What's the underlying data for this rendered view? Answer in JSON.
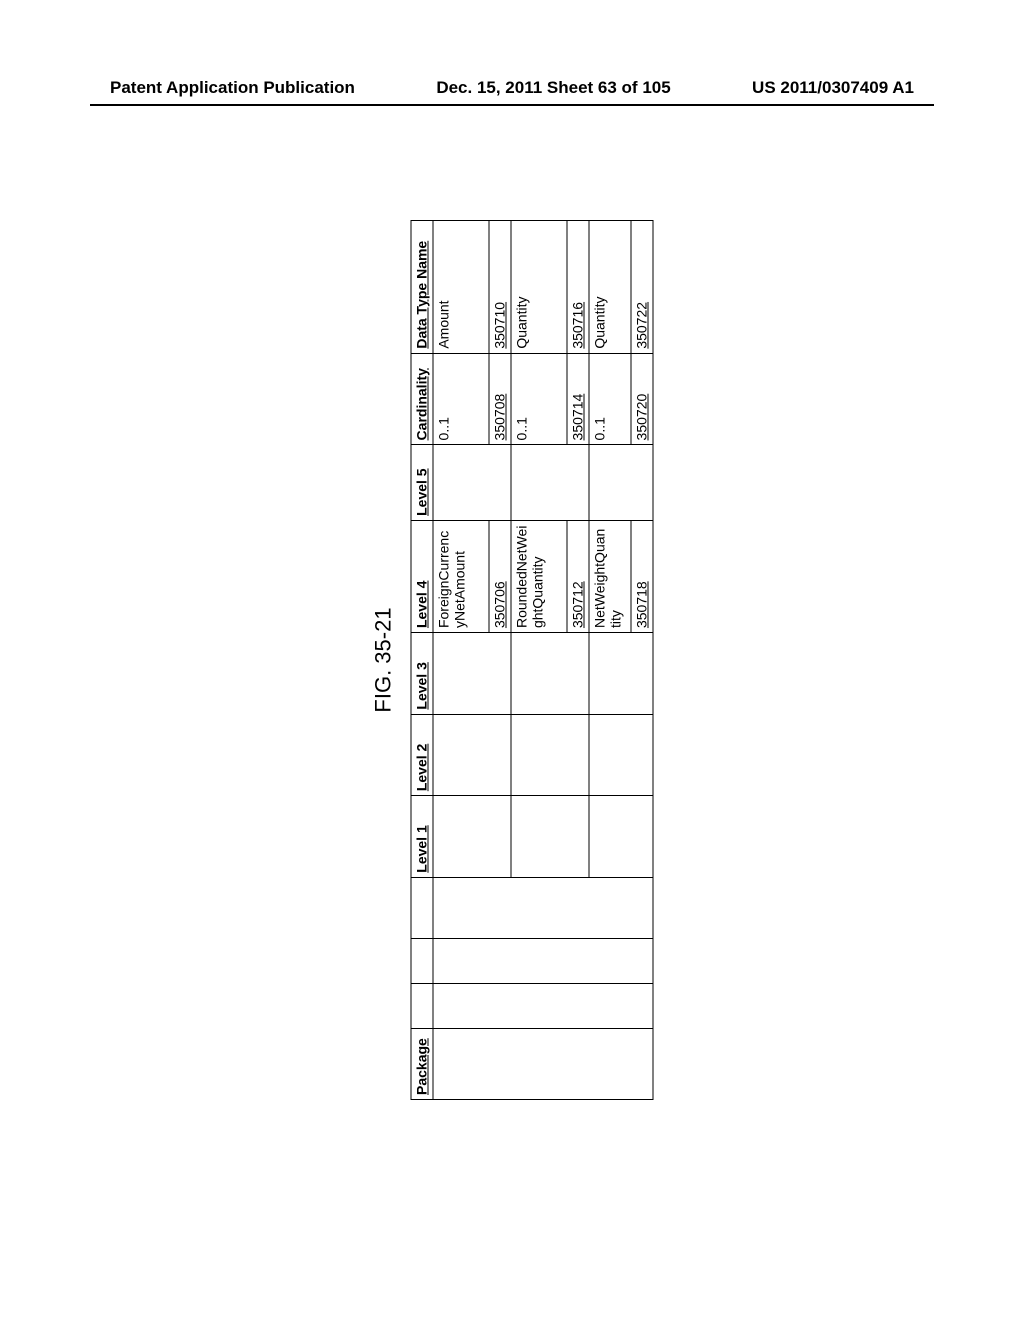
{
  "header": {
    "left": "Patent Application Publication",
    "middle": "Dec. 15, 2011  Sheet 63 of 105",
    "right": "US 2011/0307409 A1"
  },
  "figure_label": "FIG. 35-21",
  "table": {
    "columns": [
      "Package",
      "",
      "",
      "",
      "Level 1",
      "Level 2",
      "Level 3",
      "Level 4",
      "Level 5",
      "Cardinality",
      "Data Type Name"
    ],
    "rows": [
      {
        "level4": "ForeignCurrencyNetAmount",
        "level4_ref": "350706",
        "cardinality": "0..1",
        "card_ref": "350708",
        "dtn": "Amount",
        "dtn_ref": "350710"
      },
      {
        "level4": "RoundedNetWeightQuantity",
        "level4_ref": "350712",
        "cardinality": "0..1",
        "card_ref": "350714",
        "dtn": "Quantity",
        "dtn_ref": "350716"
      },
      {
        "level4": "NetWeightQuantity",
        "level4_ref": "350718",
        "cardinality": "0..1",
        "card_ref": "350720",
        "dtn": "Quantity",
        "dtn_ref": "350722"
      }
    ]
  }
}
